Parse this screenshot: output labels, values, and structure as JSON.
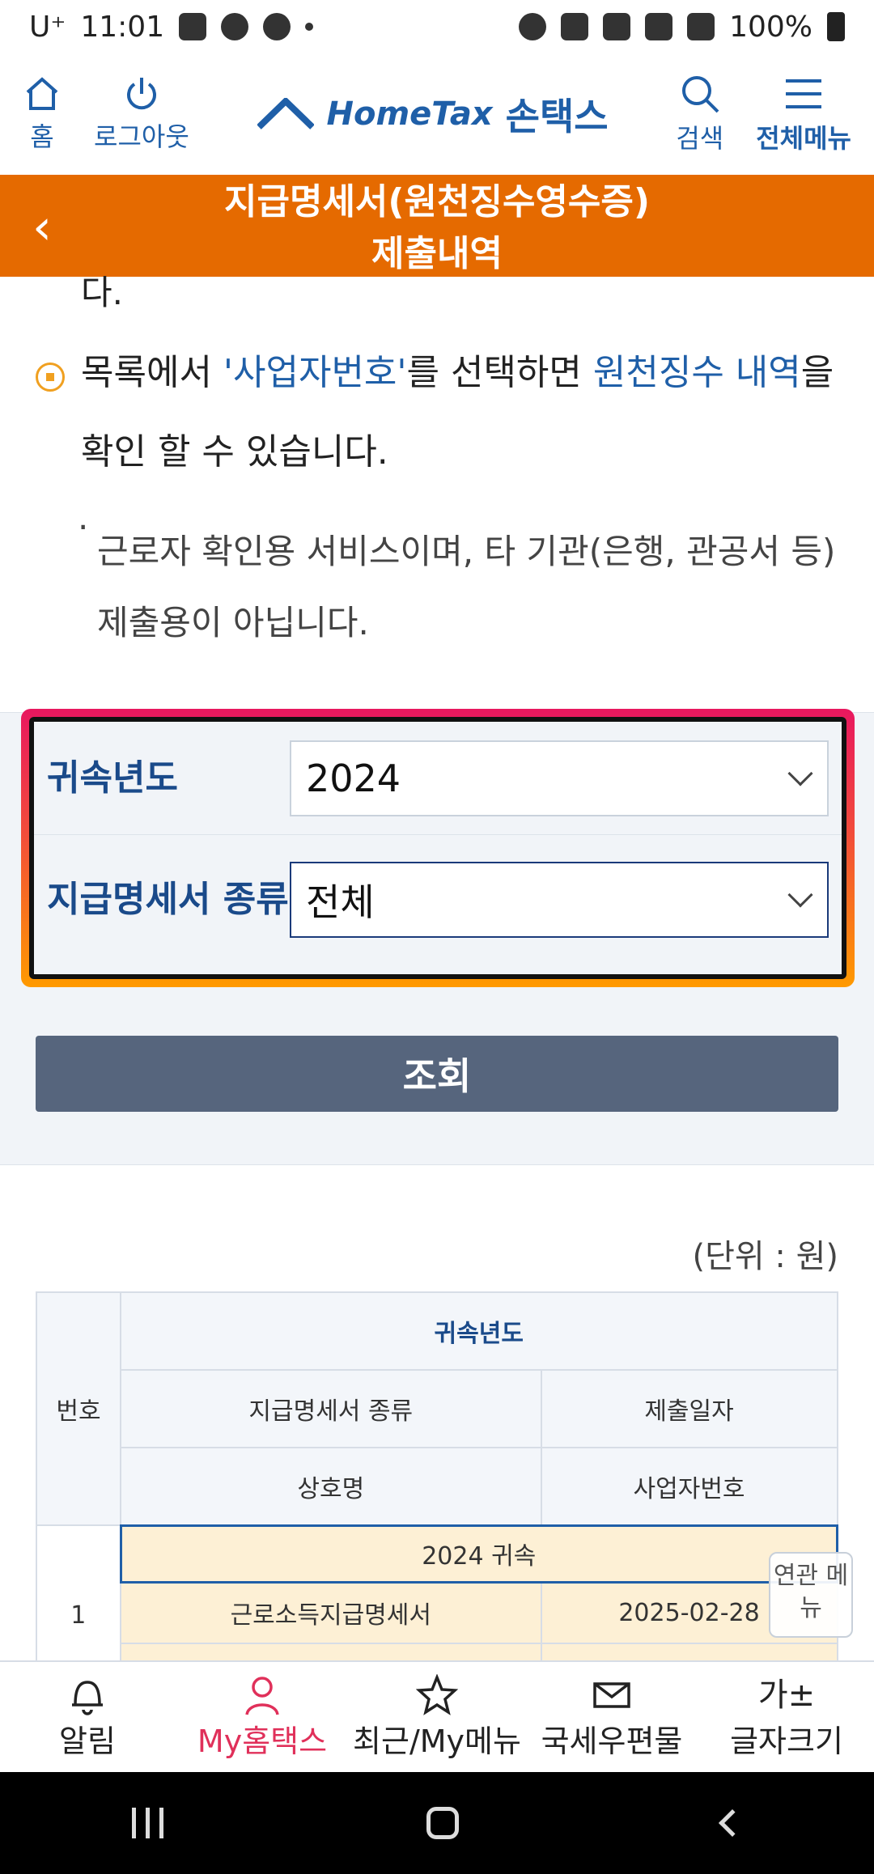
{
  "status_bar": {
    "carrier": "U⁺",
    "time": "11:01",
    "battery": "100%"
  },
  "header": {
    "home_label": "홈",
    "logout_label": "로그아웃",
    "logo_en": "HomeTax",
    "logo_ko": "손택스",
    "search_label": "검색",
    "menu_label": "전체메뉴"
  },
  "title_bar": {
    "title_line1": "지급명세서(원천징수영수증)",
    "title_line2": "제출내역"
  },
  "content": {
    "fragment": "다.",
    "note_prefix": "목록에서 ",
    "note_highlight1": "'사업자번호'",
    "note_middle": "를 선택하면 ",
    "note_highlight2": "원천징수 내역",
    "note_suffix": "을 확인 할 수 있습니다.",
    "sub_bullet": "·",
    "sub_note": "근로자 확인용 서비스이며, 타 기관(은행, 관공서 등) 제출용이 아닙니다."
  },
  "form": {
    "year_label": "귀속년도",
    "year_value": "2024",
    "type_label": "지급명세서 종류",
    "type_value": "전체",
    "search_button": "조회"
  },
  "table": {
    "unit": "(단위 : 원)",
    "headers": {
      "number": "번호",
      "year": "귀속년도",
      "statement_type": "지급명세서 종류",
      "submit_date": "제출일자",
      "company_name": "상호명",
      "business_number": "사업자번호"
    },
    "rows": [
      {
        "number": "1",
        "year_label": "2024 귀속",
        "statement_type": "근로소득지급명세서",
        "submit_date": "2025-02-28"
      }
    ]
  },
  "related_menu": "연관 메뉴",
  "bottom_nav": {
    "items": [
      {
        "label": "알림",
        "icon": "bell-icon"
      },
      {
        "label": "My홈택스",
        "icon": "person-icon"
      },
      {
        "label": "최근/My메뉴",
        "icon": "star-icon"
      },
      {
        "label": "국세우편물",
        "icon": "mail-icon"
      },
      {
        "label": "글자크기",
        "icon": "font-size-icon",
        "icon_text": "가±"
      }
    ]
  },
  "colors": {
    "accent_orange": "#e56a00",
    "brand_blue": "#1f5fa8",
    "active_pink": "#e0305a",
    "button_gray": "#56657d"
  }
}
